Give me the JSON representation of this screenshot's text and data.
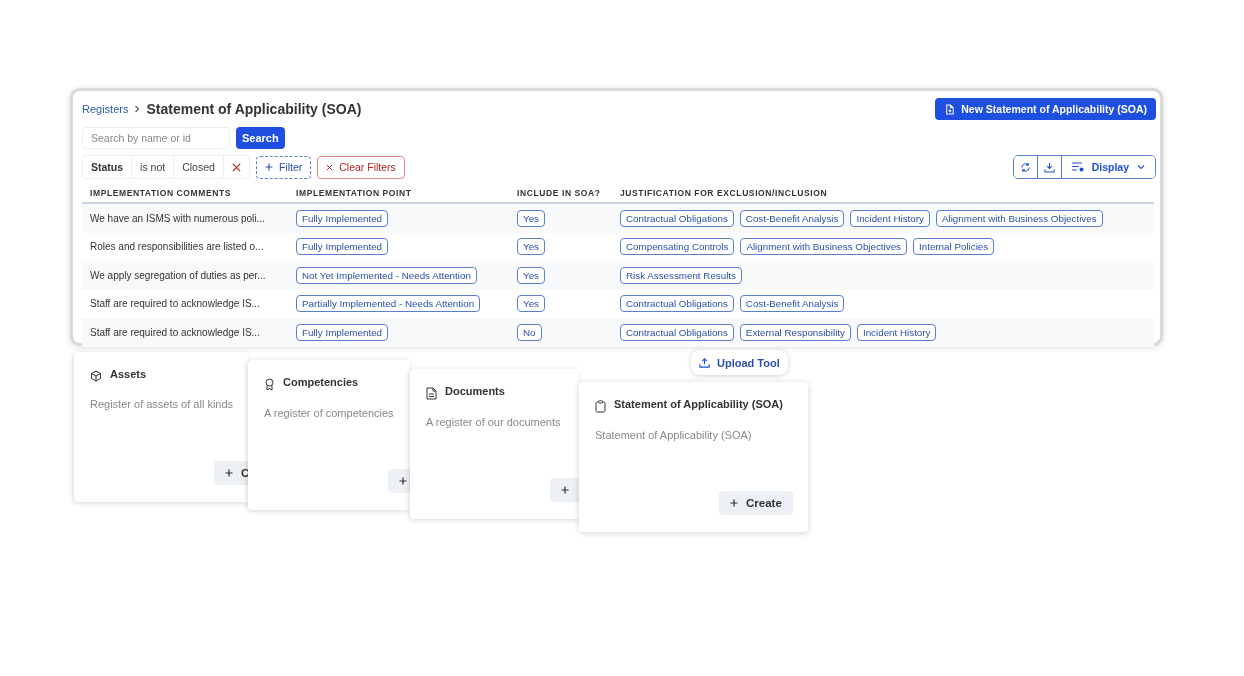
{
  "window": {
    "breadcrumb": "Registers",
    "title": "Statement of Applicability (SOA)",
    "new_button": "New Statement of Applicability (SOA)"
  },
  "search": {
    "placeholder": "Search by name or id",
    "button": "Search"
  },
  "filter_chip": {
    "field": "Status",
    "operator": "is not",
    "value": "Closed"
  },
  "filter_button": "Filter",
  "clear_button": "Clear Filters",
  "display_button": "Display",
  "table": {
    "columns": [
      "IMPLEMENTATION COMMENTS",
      "IMPLEMENTATION POINT",
      "INCLUDE IN SOA?",
      "JUSTIFICATION FOR EXCLUSION/INCLUSION"
    ],
    "rows": [
      {
        "comment": "We have an ISMS with numerous poli...",
        "point": "Fully Implemented",
        "include": "Yes",
        "justifications": [
          "Contractual Obligations",
          "Cost-Benefit Analysis",
          "Incident History",
          "Alignment with Business Objectives"
        ]
      },
      {
        "comment": "Roles and responsibilities are listed o...",
        "point": "Fully Implemented",
        "include": "Yes",
        "justifications": [
          "Compensating Controls",
          "Alignment with Business Objectives",
          "Internal Policies"
        ]
      },
      {
        "comment": "We apply segregation of duties as per...",
        "point": "Not Yet Implemented - Needs Attention",
        "include": "Yes",
        "justifications": [
          "Risk Assessment Results"
        ]
      },
      {
        "comment": "Staff are required to acknowledge IS...",
        "point": "Partially Implemented - Needs Attention",
        "include": "Yes",
        "justifications": [
          "Contractual Obligations",
          "Cost-Benefit Analysis"
        ]
      },
      {
        "comment": "Staff are required to acknowledge IS...",
        "point": "Fully Implemented",
        "include": "No",
        "justifications": [
          "Contractual Obligations",
          "External Responsibility",
          "Incident History"
        ]
      }
    ]
  },
  "upload_button": "Upload Tool",
  "cards": [
    {
      "kind": "cube",
      "title": "Assets",
      "description": "Register of assets of all kinds",
      "create_label": "C"
    },
    {
      "kind": "award",
      "title": "Competencies",
      "description": "A register of competencies"
    },
    {
      "kind": "document",
      "title": "Documents",
      "description": "A register of our documents"
    },
    {
      "kind": "clipboard",
      "title": "Statement of Applicability (SOA)",
      "description": "Statement of Applicability (SOA)",
      "create_label": "Create"
    }
  ]
}
